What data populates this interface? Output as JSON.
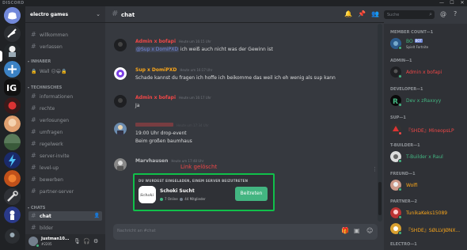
{
  "app": {
    "brand": "DISCORD"
  },
  "window": {
    "minimize": "—",
    "maximize": "☐",
    "close": "✕"
  },
  "guild": {
    "name": "electro games"
  },
  "sidebar": {
    "channels_top": [
      {
        "name": "willkommen"
      },
      {
        "name": "verlassen"
      }
    ],
    "cat_info": "INHABER",
    "voice_channel": "Wall 😐😀🔒",
    "cat_tech": "TECHNISCHES",
    "channels_tech": [
      {
        "name": "informationen"
      },
      {
        "name": "rechte"
      },
      {
        "name": "verlosungen"
      },
      {
        "name": "umfragen"
      },
      {
        "name": "regelwerk"
      },
      {
        "name": "server-invite"
      },
      {
        "name": "level-up"
      },
      {
        "name": "bewerben"
      },
      {
        "name": "partner-server"
      }
    ],
    "cat_chats": "CHATS",
    "channels_chat": [
      {
        "name": "chat",
        "selected": true
      },
      {
        "name": "bilder"
      }
    ]
  },
  "user": {
    "name": "Justman10...",
    "tag": "#2205"
  },
  "chat": {
    "hash": "#",
    "title": "chat",
    "search_placeholder": "Suche",
    "composer_placeholder": "Nachricht an #chat"
  },
  "messages": [
    {
      "author": "Admin x bofapi",
      "color": "#f04747",
      "ts": "Heute um 16:15 Uhr",
      "lines": [
        "ich weiß auch nicht was der Gewinn ist"
      ],
      "mention": "@Sup x DomiPXD"
    },
    {
      "author": "Sup x DomiPXD",
      "color": "#faa61a",
      "ts": "Heute um 16:17 Uhr",
      "lines": [
        "Schade kannst du fragen ich hoffe ich beikomme das weil ich eh wenig als sup kann"
      ]
    },
    {
      "author": "Admin x bofapi",
      "color": "#f04747",
      "ts": "Heute um 16:17 Uhr",
      "lines": [
        "Ja"
      ]
    },
    {
      "author": "",
      "color": "#f04747",
      "ts": "Heute um 17:34 Uhr",
      "lines": [
        "19:00 Uhr drop-event",
        "Beim großen baumhaus"
      ]
    },
    {
      "author": "Marvhausen",
      "color": "#b9bbbe",
      "ts": "Heute um 17:48 Uhr",
      "lines": []
    }
  ],
  "annotation": {
    "text": "Link gelöscht",
    "color": "#f04747"
  },
  "invite": {
    "header": "DU WURDEST EINGELADEN, EINEM SERVER BEIZUTRETEN",
    "server_name": "Schoki Sucht",
    "online": "7 Online",
    "members": "44 Mitglieder",
    "join_label": "Beitreten",
    "icon_text": "Schoki",
    "border_color": "#10c04a"
  },
  "member_list": {
    "categories": [
      {
        "label": "MEMBER COUNT—1",
        "members": [
          {
            "name": "BO",
            "sub": "Spielt Fortnite",
            "color": "#43b581",
            "bot": "BOT"
          }
        ]
      },
      {
        "label": "ADMIN—1",
        "members": [
          {
            "name": "Admin x bofapi",
            "color": "#f04747"
          }
        ]
      },
      {
        "label": "DEVELOPER—1",
        "members": [
          {
            "name": "Dev x zRaxxyy",
            "color": "#43b581"
          }
        ]
      },
      {
        "label": "SUP—1",
        "members": [
          {
            "name": "『SHDE』MineopsLP",
            "color": "#f04747"
          }
        ]
      },
      {
        "label": "T-BUILDER—1",
        "members": [
          {
            "name": "T-Builder x Raul",
            "color": "#43b581"
          }
        ]
      },
      {
        "label": "FREUND—1",
        "members": [
          {
            "name": "Wolfi",
            "color": "#faa61a"
          }
        ]
      },
      {
        "label": "PARTNER—2",
        "members": [
          {
            "name": "TunikaKeks15089",
            "color": "#faa61a"
          },
          {
            "name": "『SHDE』SØLLVJØNX...",
            "color": "#faa61a"
          }
        ]
      },
      {
        "label": "ELECTRO—1",
        "members": []
      }
    ]
  },
  "colors": {
    "accent": "#7289da",
    "green": "#43b581",
    "red": "#f04747"
  }
}
